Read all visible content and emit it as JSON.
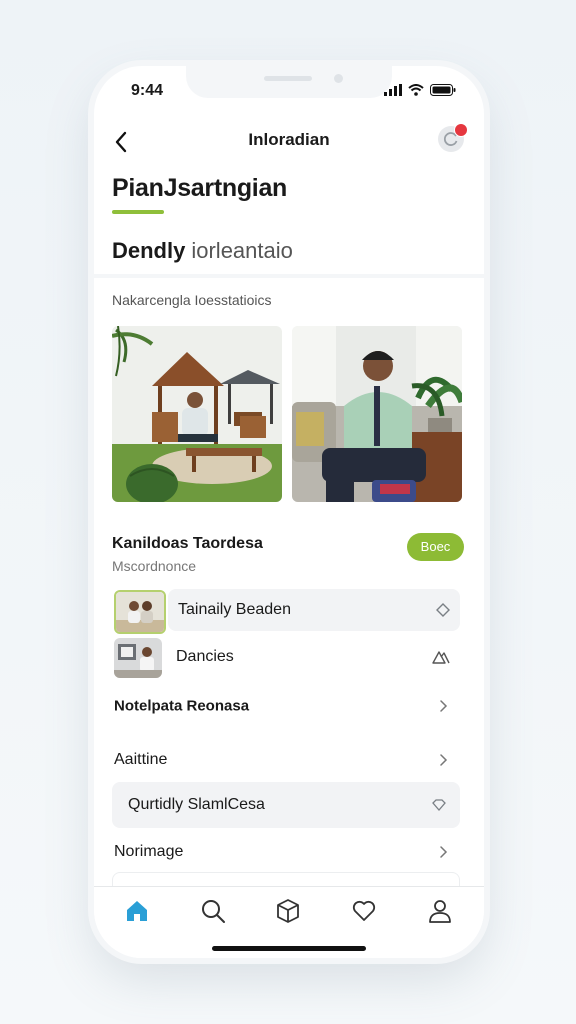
{
  "status_bar": {
    "time": "9:44"
  },
  "header": {
    "title": "Inloradian",
    "back_icon": "chevron-left-icon",
    "notification_icon": "refresh-icon"
  },
  "page": {
    "title": "PianJsartngian",
    "subtitle_strong": "Dendly",
    "subtitle_light": "iorleantaio",
    "section_caption": "Nakarcengla Ioesstatioics"
  },
  "card": {
    "title": "Kanildoas Taordesa",
    "subtitle": "Mscordnonce",
    "button_label": "Boec"
  },
  "list": [
    {
      "label": "Tainaily Beaden",
      "trail_icon": "diamond-icon",
      "shaded": true,
      "thumb": true
    },
    {
      "label": "Dancies",
      "trail_icon": "mountain-icon",
      "shaded": false,
      "thumb": true
    },
    {
      "label": "Notelpata Reonasa",
      "trail_icon": "chevron-right-icon",
      "shaded": false,
      "thumb": false
    },
    {
      "label": "Aaittine",
      "trail_icon": "chevron-right-icon",
      "shaded": false,
      "thumb": false
    },
    {
      "label": "Qurtidly SlamlCesa",
      "trail_icon": "diamond-icon",
      "shaded": true,
      "thumb": false
    },
    {
      "label": "Norimage",
      "trail_icon": "chevron-right-icon",
      "shaded": false,
      "thumb": false
    }
  ],
  "tabbar": {
    "tabs": [
      {
        "icon": "home-icon",
        "active": true
      },
      {
        "icon": "search-icon",
        "active": false
      },
      {
        "icon": "box-icon",
        "active": false
      },
      {
        "icon": "heart-icon",
        "active": false
      },
      {
        "icon": "profile-icon",
        "active": false
      }
    ]
  },
  "colors": {
    "accent_green": "#8dbb35",
    "active_tab_blue": "#2a9fd6",
    "badge_red": "#e5373f"
  }
}
